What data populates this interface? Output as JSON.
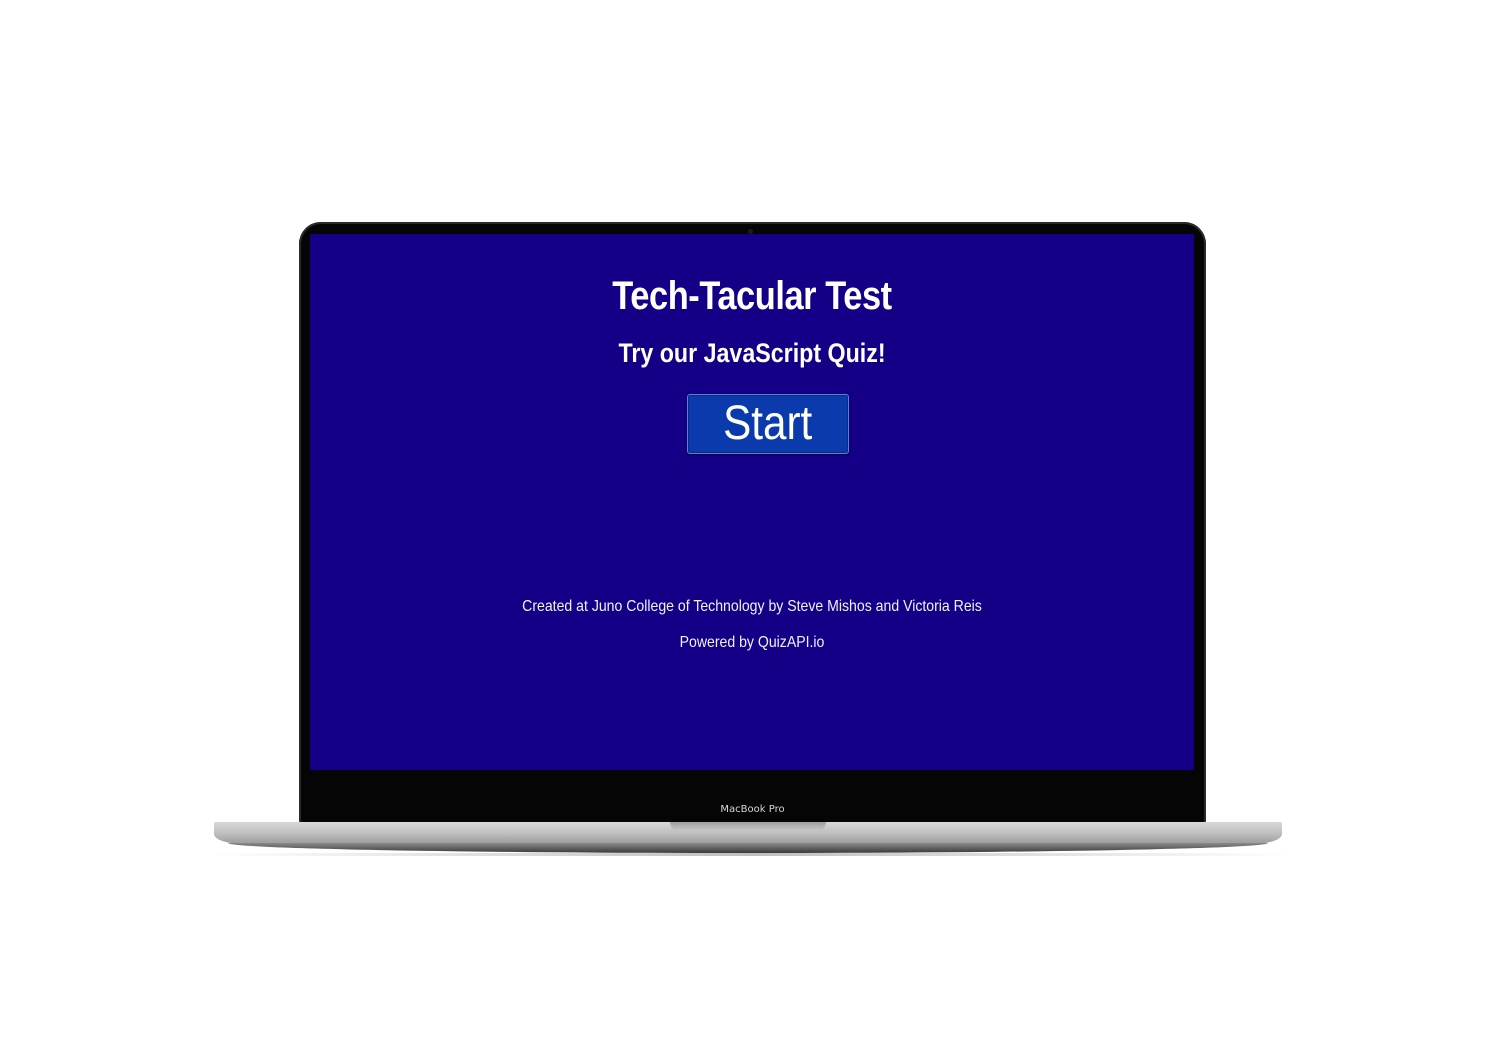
{
  "app": {
    "title": "Tech-Tacular Test",
    "subtitle": "Try our JavaScript Quiz!",
    "start_label": "Start",
    "footer_credit": "Created at Juno College of Technology by Steve Mishos and Victoria Reis",
    "footer_powered": "Powered by QuizAPI.io"
  },
  "device": {
    "model_label": "MacBook Pro"
  },
  "colors": {
    "screen_background": "#140087",
    "button_background": "#0b3aad",
    "text": "#ffffff"
  }
}
